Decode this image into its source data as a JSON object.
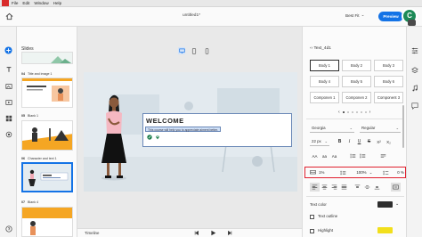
{
  "menubar": {
    "items": [
      "File",
      "Edit",
      "Window",
      "Help"
    ]
  },
  "titlebar": {
    "doc_title": "untitled1*",
    "zoom_label": "Best Fit",
    "preview_label": "Preview",
    "avatar_letter": "C"
  },
  "slides_panel": {
    "title": "Slides",
    "slides": [
      {
        "num": "04",
        "name": "Title and image 1"
      },
      {
        "num": "05",
        "name": "Blank 1"
      },
      {
        "num": "06",
        "name": "Character and text 1"
      },
      {
        "num": "07",
        "name": "Blank 4"
      }
    ]
  },
  "canvas": {
    "heading": "WELCOME",
    "body_text": "This course will help you to appreciate aiment better."
  },
  "timeline": {
    "label": "Timeline"
  },
  "properties": {
    "header": "Text_4d1",
    "styles": [
      "Body 1",
      "Body 2",
      "Body 3",
      "Body 4",
      "Body 5",
      "Body 6",
      "Componen 1",
      "Componen 2",
      "Component 3"
    ],
    "font_family": "Georgia",
    "font_weight": "Regular",
    "font_size": "22 px",
    "char_spacing": "1%",
    "line_spacing": "100%",
    "para_spacing": "0 %",
    "text_color_label": "Text color",
    "text_outline_label": "Text outline",
    "highlight_label": "Highlight",
    "colors": {
      "text_color": "#2d2d2d",
      "highlight": "#f2df1c",
      "accent": "#1473e6",
      "selection_box": "#e0202e"
    }
  }
}
